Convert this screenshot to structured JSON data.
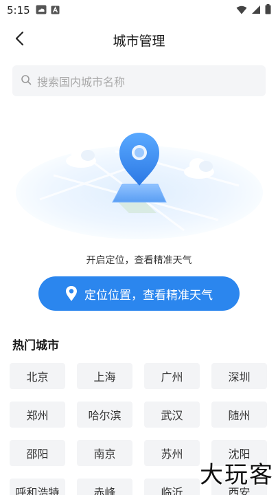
{
  "status_bar": {
    "time": "5:15"
  },
  "header": {
    "title": "城市管理"
  },
  "search": {
    "placeholder": "搜索国内城市名称"
  },
  "locate": {
    "hint": "开启定位，查看精准天气",
    "button_label": "定位位置，查看精准天气"
  },
  "hot": {
    "title": "热门城市",
    "cities": [
      "北京",
      "上海",
      "广州",
      "深圳",
      "郑州",
      "哈尔滨",
      "武汉",
      "随州",
      "邵阳",
      "南京",
      "苏州",
      "沈阳",
      "呼和浩特",
      "赤峰",
      "临沂",
      "西安"
    ]
  },
  "watermark": {
    "text": "大玩客"
  },
  "colors": {
    "accent": "#2b86ee",
    "tile_bg": "#f3f4f6",
    "search_bg": "#f4f5f7"
  }
}
